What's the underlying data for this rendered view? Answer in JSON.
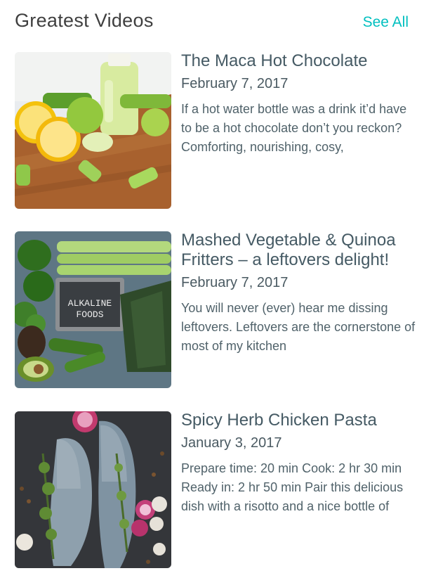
{
  "section": {
    "title": "Greatest Videos",
    "see_all_label": "See All"
  },
  "videos": [
    {
      "title": "The Maca Hot Chocolate",
      "date": "February 7, 2017",
      "excerpt": "If a hot water bottle was a drink it’d have to be a hot chocolate don’t you reckon? Comforting, nourishing, cosy,"
    },
    {
      "title": "Mashed Vegetable & Quinoa Fritters – a leftovers delight!",
      "date": "February 7, 2017",
      "excerpt": "You will never (ever) hear me dissing leftovers. Leftovers are the cornerstone of most of my kitchen",
      "thumbnail_text": [
        "ALKALINE",
        "FOODS"
      ]
    },
    {
      "title": "Spicy Herb Chicken Pasta",
      "date": "January 3, 2017",
      "excerpt": "Prepare time: 20 min Cook: 2 hr 30 min Ready in: 2 hr 50 min Pair this delicious dish with a risotto and a nice bottle of"
    }
  ]
}
